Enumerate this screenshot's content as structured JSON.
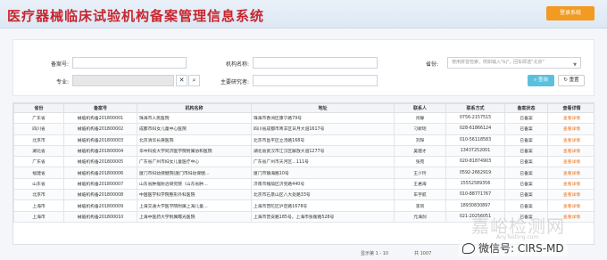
{
  "header": {
    "title": "医疗器械临床试验机构备案管理信息系统",
    "login_label": "登录系统"
  },
  "search": {
    "record_no_label": "备案号:",
    "org_name_label": "机构名称:",
    "province_label": "省份:",
    "province_placeholder": "使用拼音检索，例如输入\"bj\"，回车即选\"北京\"",
    "specialty_label": "专业:",
    "main_researcher_label": "主要研究者:",
    "search_label": "查询",
    "reset_label": "重置"
  },
  "table": {
    "headers": [
      "省份",
      "备案号",
      "机构名称",
      "地址",
      "联系人",
      "联系方式",
      "备案状态",
      "查看详情"
    ],
    "rows": [
      [
        "广东省",
        "械临机构备201800001",
        "珠海市人民医院",
        "珠海市香洲区康宁路79号",
        "肖静",
        "0756-2157515",
        "已备案",
        "查看详情"
      ],
      [
        "四川省",
        "械临机构备201800002",
        "成都市妇女儿童中心医院",
        "四川省成都市青羊区日月大道1617号",
        "刁新瑶",
        "028-61866124",
        "已备案",
        "查看详情"
      ],
      [
        "北京市",
        "械临机构备201800003",
        "北京清华长庚医院",
        "北京市昌平区立汤路168号",
        "刘琛",
        "010-56118583",
        "已备案",
        "查看详情"
      ],
      [
        "湖北省",
        "械临机构备201800004",
        "华中科技大学同济医学院附属协和医院",
        "湖北省武汉市江汉区解放大道1277号",
        "吴建才",
        "13437252001",
        "已备案",
        "查看详情"
      ],
      [
        "广东省",
        "械临机构备201800005",
        "广东省广州市妇女儿童医疗中心",
        "广东省广州市天河区…111号",
        "张苑",
        "020-81874903",
        "已备案",
        "查看详情"
      ],
      [
        "福建省",
        "械临机构备201800006",
        "厦门市妇幼保健院(厦门市妇幼保健…",
        "厦门市镇海路10号",
        "王少玲",
        "0592-2662919",
        "已备案",
        "查看详情"
      ],
      [
        "山东省",
        "械临机构备201800007",
        "山东省肿瘤防治研究院（山东省肿…",
        "济南市槐荫区济兖路440号",
        "王君海",
        "15552589356",
        "已备案",
        "查看详情"
      ],
      [
        "北京市",
        "械临机构备201800008",
        "中国医学科学院整形外科医院",
        "北京市石景山区八大处路33号",
        "车宇航",
        "010-88771767",
        "已备案",
        "查看详情"
      ],
      [
        "上海市",
        "械临机构备201800009",
        "上海交通大学医学院附属上海儿童…",
        "上海市普陀区泸定路1678号",
        "李凤",
        "18930830897",
        "已备案",
        "查看详情"
      ],
      [
        "上海市",
        "械临机构备201800010",
        "上海中医药大学附属曙光医院",
        "上海市普安路185号，上海市张衡路528号",
        "元海剑",
        "021-20256051",
        "已备案",
        "查看详情"
      ]
    ]
  },
  "pager": {
    "info": "显示第 1 - 10",
    "total": "共 1007"
  },
  "watermark": {
    "brand": "嘉峪检测网",
    "url": "AnyTesting.com",
    "wechat": "微信号: CIRS-MD"
  }
}
